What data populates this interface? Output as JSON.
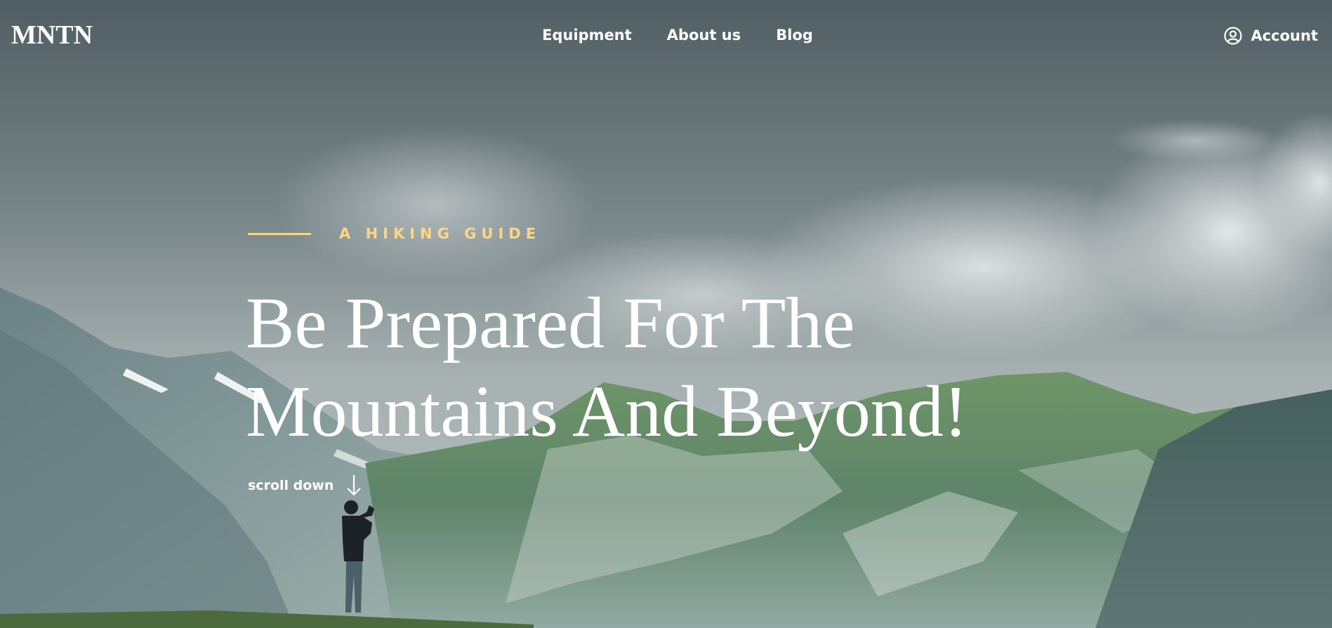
{
  "brand": {
    "logo": "MNTN"
  },
  "nav": {
    "items": [
      {
        "label": "Equipment"
      },
      {
        "label": "About us"
      },
      {
        "label": "Blog"
      }
    ]
  },
  "account": {
    "label": "Account",
    "icon": "user-circle-icon"
  },
  "hero": {
    "eyebrow": "A HIKING GUIDE",
    "headline_line1": "Be Prepared For The",
    "headline_line2": "Mountains And Beyond!",
    "scroll_label": "scroll down",
    "scroll_icon": "arrow-down-icon",
    "accent_color": "#fbd784"
  }
}
